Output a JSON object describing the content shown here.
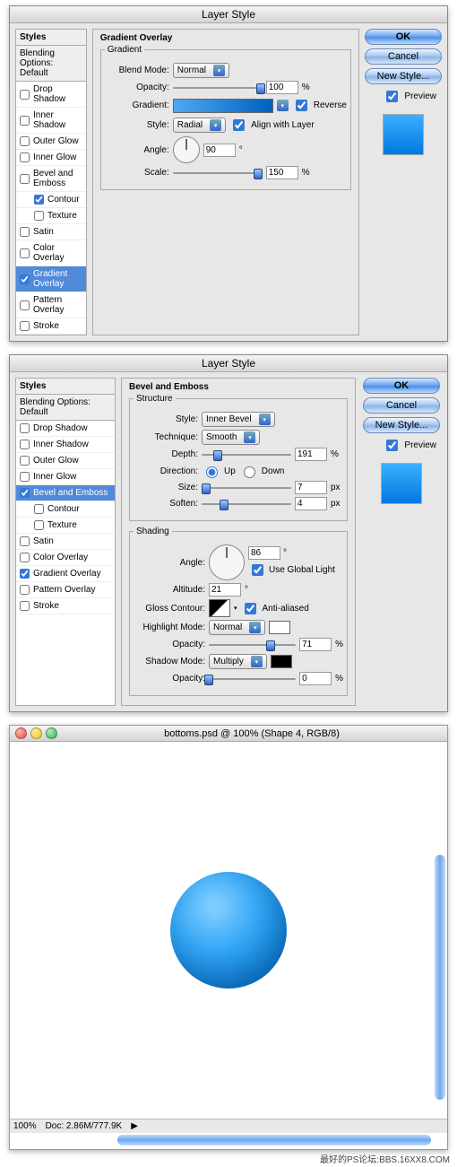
{
  "dialog_title": "Layer Style",
  "styles_header": "Styles",
  "blending_header": "Blending Options: Default",
  "style_items": [
    {
      "label": "Drop Shadow",
      "checked": false
    },
    {
      "label": "Inner Shadow",
      "checked": false
    },
    {
      "label": "Outer Glow",
      "checked": false
    },
    {
      "label": "Inner Glow",
      "checked": false
    },
    {
      "label": "Bevel and Emboss",
      "checked": false
    },
    {
      "label": "Contour",
      "checked": true,
      "indent": true
    },
    {
      "label": "Texture",
      "checked": false,
      "indent": true
    },
    {
      "label": "Satin",
      "checked": false
    },
    {
      "label": "Color Overlay",
      "checked": false
    },
    {
      "label": "Gradient Overlay",
      "checked": true
    },
    {
      "label": "Pattern Overlay",
      "checked": false
    },
    {
      "label": "Stroke",
      "checked": false
    }
  ],
  "buttons": {
    "ok": "OK",
    "cancel": "Cancel",
    "new_style": "New Style...",
    "preview": "Preview"
  },
  "panel1": {
    "title": "Gradient Overlay",
    "group": "Gradient",
    "blend_mode_label": "Blend Mode:",
    "blend_mode": "Normal",
    "opacity_label": "Opacity:",
    "opacity": "100",
    "pct": "%",
    "gradient_label": "Gradient:",
    "reverse": "Reverse",
    "style_label": "Style:",
    "style": "Radial",
    "align": "Align with Layer",
    "angle_label": "Angle:",
    "angle": "90",
    "deg": "°",
    "scale_label": "Scale:",
    "scale": "150"
  },
  "panel2": {
    "title": "Bevel and Emboss",
    "structure": "Structure",
    "style_label": "Style:",
    "style": "Inner Bevel",
    "technique_label": "Technique:",
    "technique": "Smooth",
    "depth_label": "Depth:",
    "depth": "191",
    "pct": "%",
    "direction_label": "Direction:",
    "up": "Up",
    "down": "Down",
    "size_label": "Size:",
    "size": "7",
    "px": "px",
    "soften_label": "Soften:",
    "soften": "4",
    "shading": "Shading",
    "angle_label": "Angle:",
    "angle": "86",
    "deg": "°",
    "use_global": "Use Global Light",
    "altitude_label": "Altitude:",
    "altitude": "21",
    "gloss_label": "Gloss Contour:",
    "anti": "Anti-aliased",
    "highlight_label": "Highlight Mode:",
    "highlight": "Normal",
    "h_opacity": "71",
    "shadow_label": "Shadow Mode:",
    "shadow": "Multiply",
    "s_opacity": "0",
    "opacity_label": "Opacity:"
  },
  "style_items2": [
    {
      "label": "Drop Shadow",
      "checked": false
    },
    {
      "label": "Inner Shadow",
      "checked": false
    },
    {
      "label": "Outer Glow",
      "checked": false
    },
    {
      "label": "Inner Glow",
      "checked": false
    },
    {
      "label": "Bevel and Emboss",
      "checked": true
    },
    {
      "label": "Contour",
      "checked": false,
      "indent": true
    },
    {
      "label": "Texture",
      "checked": false,
      "indent": true
    },
    {
      "label": "Satin",
      "checked": false
    },
    {
      "label": "Color Overlay",
      "checked": false
    },
    {
      "label": "Gradient Overlay",
      "checked": true
    },
    {
      "label": "Pattern Overlay",
      "checked": false
    },
    {
      "label": "Stroke",
      "checked": false
    }
  ],
  "doc": {
    "title": "bottoms.psd @ 100% (Shape 4, RGB/8)",
    "zoom": "100%",
    "status": "Doc: 2.86M/777.9K"
  },
  "watermark": "最好的PS论坛:BBS.16XX8.COM"
}
